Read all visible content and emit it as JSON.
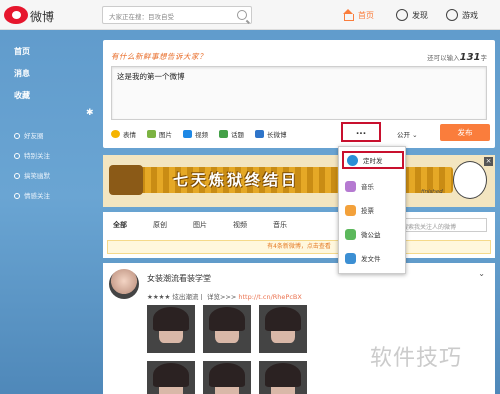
{
  "topbar": {
    "logo_text": "微博",
    "search_placeholder": "大家正在搜：目攻自受",
    "nav": [
      {
        "label": "首页",
        "icon": "home-icon"
      },
      {
        "label": "发现",
        "icon": "compass-icon"
      },
      {
        "label": "游戏",
        "icon": "game-icon"
      }
    ]
  },
  "sidebar": {
    "main": [
      "首页",
      "消息",
      "收藏"
    ],
    "sub": [
      "好友圈",
      "特别关注",
      "搞笑幽默",
      "情感关注"
    ]
  },
  "composer": {
    "prompt": "有什么新鲜事想告诉大家？",
    "remain_prefix": "还可以输入",
    "remain_count": "131",
    "remain_suffix": "字",
    "text": "这是我的第一个微博",
    "tools": [
      "表情",
      "图片",
      "视频",
      "话题",
      "长微博"
    ],
    "more_label": "...",
    "visibility": "公开",
    "publish_label": "发布"
  },
  "banner": {
    "text": "七天炼狱终结日",
    "tag": "finished"
  },
  "feedbar": {
    "tabs": [
      "全部",
      "原创",
      "图片",
      "视频",
      "音乐"
    ],
    "search_placeholder": "搜索我关注人的微博",
    "notice": "有4条新微博，点击查看"
  },
  "post": {
    "author": "女装潮流看装学堂",
    "line_prefix": "★★★★ 炫出潮流丨 详览>>> ",
    "line_link": "http://t.cn/RhePcBX"
  },
  "menu": {
    "items": [
      {
        "label": "定时发",
        "icon": "clock-icon",
        "color": "#2a8fd6"
      },
      {
        "label": "音乐",
        "icon": "music-icon",
        "color": "#b57ad1"
      },
      {
        "label": "投票",
        "icon": "vote-icon",
        "color": "#f3a13b"
      },
      {
        "label": "微公益",
        "icon": "charity-icon",
        "color": "#5cb85c"
      },
      {
        "label": "发文件",
        "icon": "file-icon",
        "color": "#3c8fd3"
      }
    ]
  },
  "watermark": "软件技巧"
}
